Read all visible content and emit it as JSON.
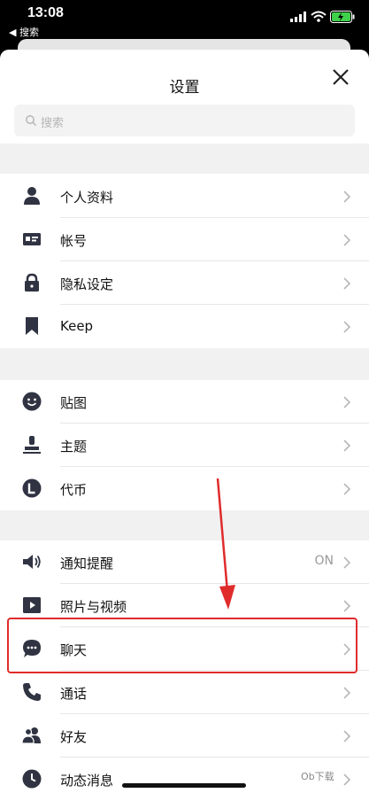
{
  "status": {
    "time": "13:08",
    "back_label": "◀ 搜索"
  },
  "header": {
    "title": "设置"
  },
  "search": {
    "placeholder": "搜索"
  },
  "accent": "#e02b2b",
  "icon_color": "#2f3342",
  "sections": [
    [
      {
        "id": "profile",
        "label": "个人资料",
        "icon": "person-icon"
      },
      {
        "id": "account",
        "label": "帐号",
        "icon": "id-card-icon"
      },
      {
        "id": "privacy",
        "label": "隐私设定",
        "icon": "lock-icon"
      },
      {
        "id": "keep",
        "label": "Keep",
        "icon": "bookmark-icon"
      }
    ],
    [
      {
        "id": "stickers",
        "label": "贴图",
        "icon": "smiley-icon"
      },
      {
        "id": "themes",
        "label": "主题",
        "icon": "stamp-icon"
      },
      {
        "id": "coins",
        "label": "代币",
        "icon": "coin-icon"
      }
    ],
    [
      {
        "id": "notifications",
        "label": "通知提醒",
        "value": "ON",
        "icon": "speaker-icon"
      },
      {
        "id": "photos-videos",
        "label": "照片与视频",
        "icon": "play-icon"
      },
      {
        "id": "chats",
        "label": "聊天",
        "icon": "chat-bubble-icon"
      },
      {
        "id": "calls",
        "label": "通话",
        "icon": "phone-icon"
      },
      {
        "id": "friends",
        "label": "好友",
        "icon": "friends-icon"
      },
      {
        "id": "timeline",
        "label": "动态消息",
        "icon": "clock-icon"
      }
    ]
  ],
  "watermark": "Ob下载"
}
